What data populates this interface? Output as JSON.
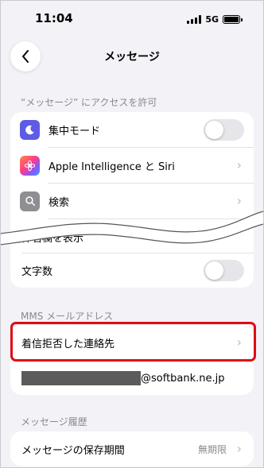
{
  "status_bar": {
    "time": "11:04",
    "network": "5G"
  },
  "nav": {
    "title": "メッセージ"
  },
  "access": {
    "header": "“メッセージ” にアクセスを許可",
    "items": [
      {
        "label": "集中モード",
        "icon": "moon-icon",
        "control": "toggle",
        "toggle_on": false
      },
      {
        "label": "Apple Intelligence と Siri",
        "icon": "siri-icon",
        "control": "chevron"
      },
      {
        "label": "検索",
        "icon": "search-icon",
        "control": "chevron"
      },
      {
        "label": "件名欄を表示",
        "control": "none"
      },
      {
        "label": "文字数",
        "control": "toggle",
        "toggle_on": false
      }
    ]
  },
  "mms": {
    "header": "MMS メールアドレス",
    "blocked_contacts_label": "着信拒否した連絡先",
    "email_domain": "@softbank.ne.jp"
  },
  "history": {
    "header": "メッセージ履歴",
    "keep_label": "メッセージの保存期間",
    "keep_value": "無期限"
  },
  "colors": {
    "background": "#f2f2f7",
    "highlight": "#e10a14",
    "focus_icon": "#5e5ce6",
    "secondary_text": "#8a8a8e"
  }
}
